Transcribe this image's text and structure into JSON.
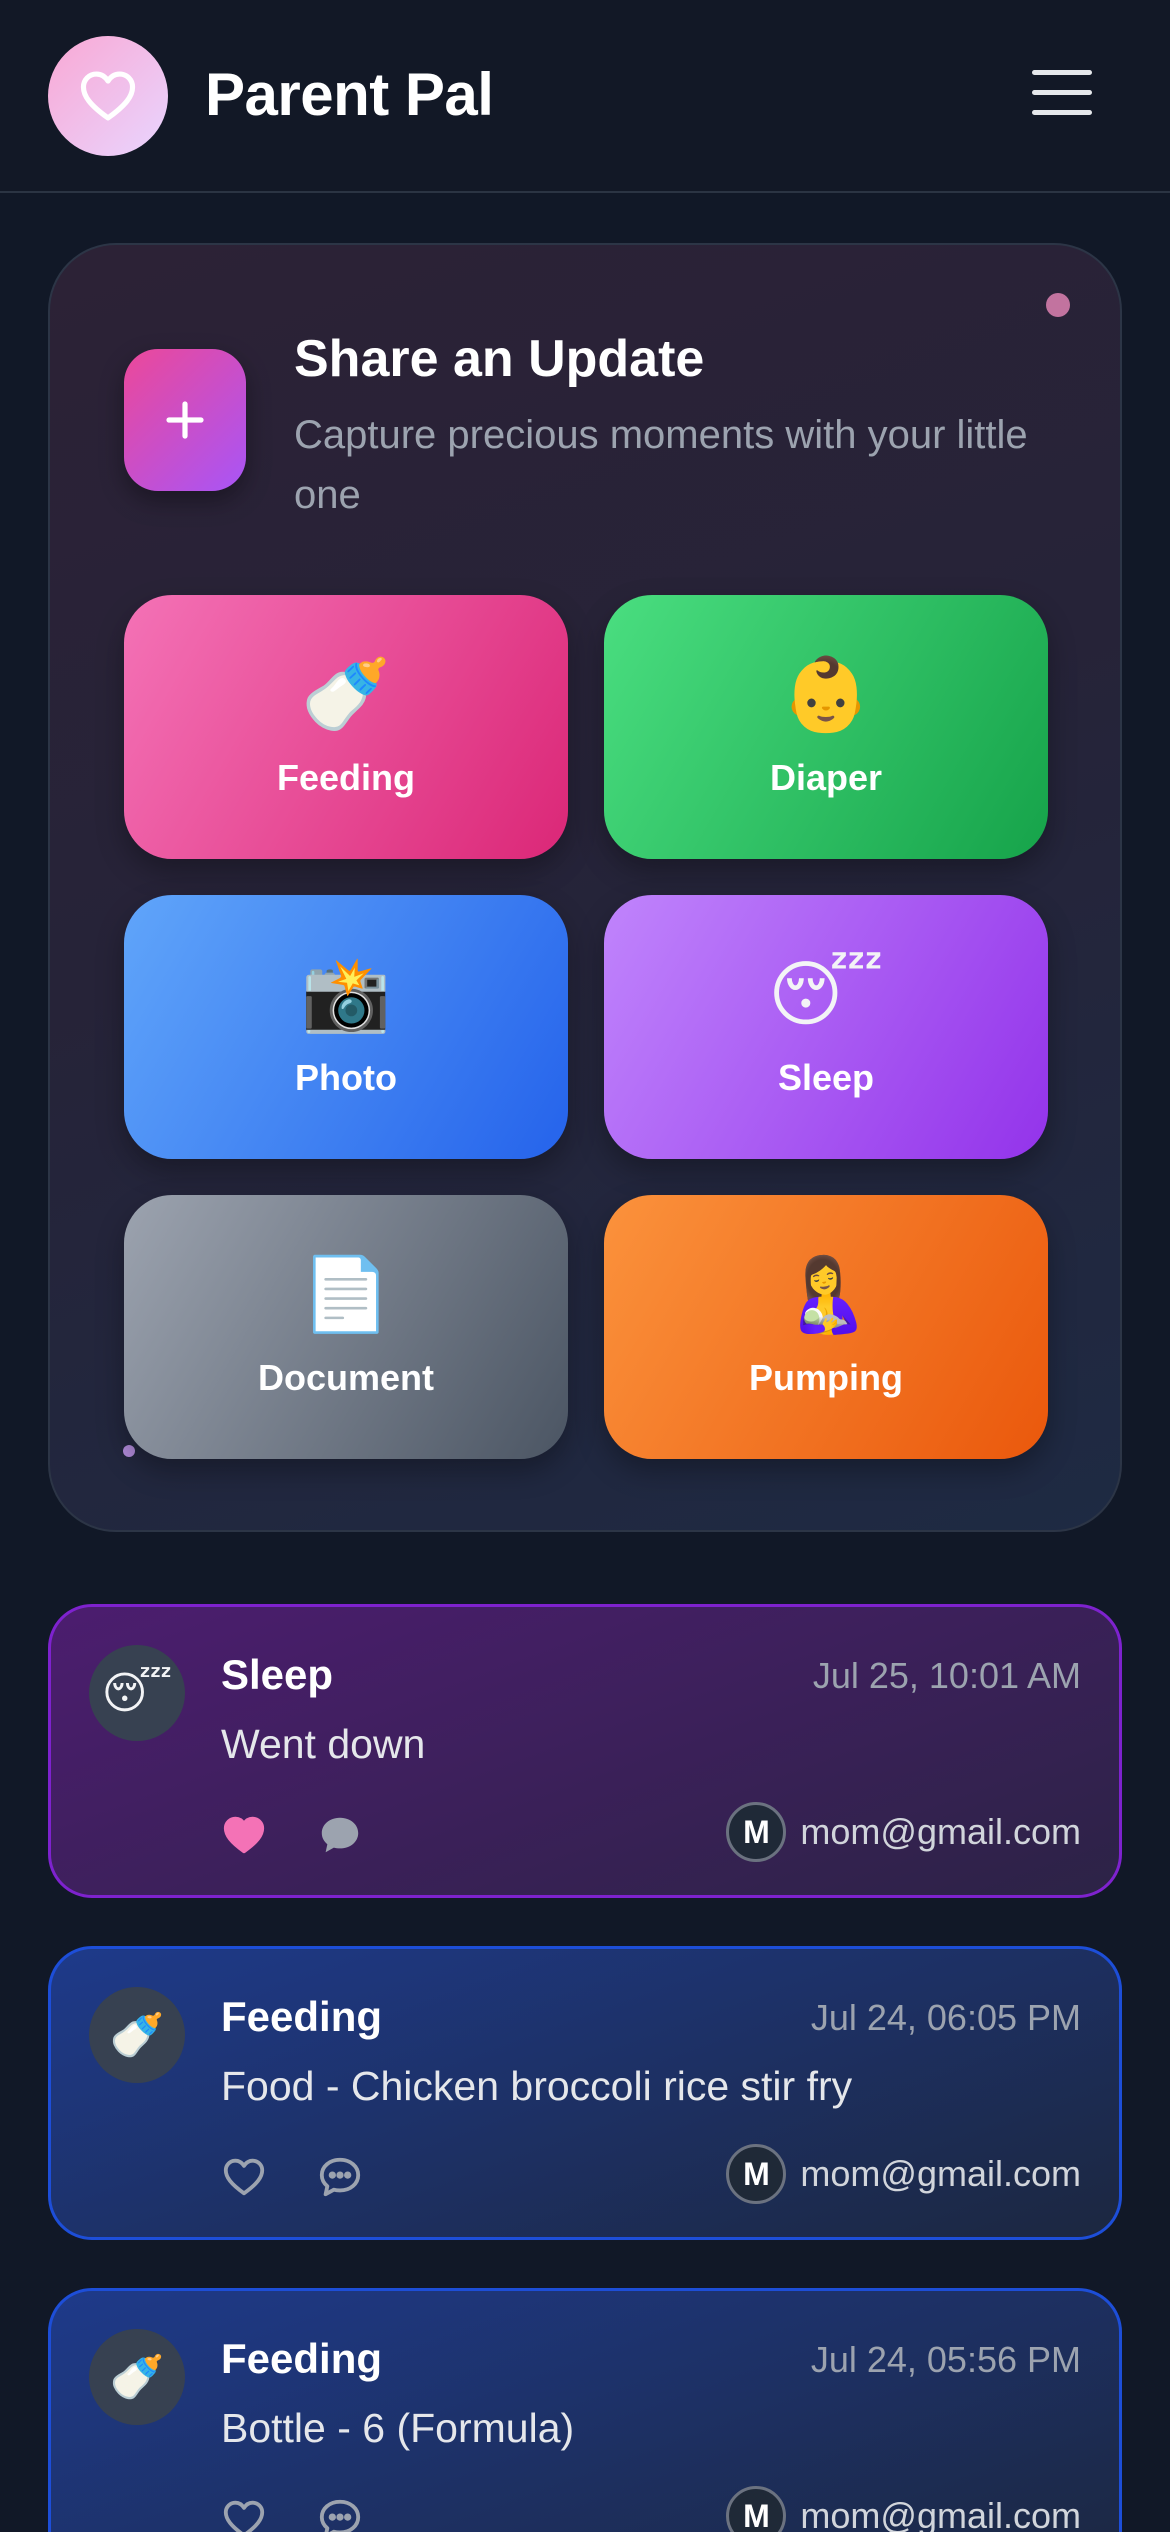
{
  "header": {
    "logo_icon": "heart-icon",
    "title": "Parent Pal",
    "menu_icon": "hamburger-menu-icon"
  },
  "share": {
    "plus_icon": "plus-icon",
    "title": "Share an Update",
    "subtitle": "Capture precious moments with your little one",
    "tiles": [
      {
        "emoji": "🍼",
        "label": "Feeding",
        "color": "#ec4899"
      },
      {
        "emoji": "👶",
        "label": "Diaper",
        "color": "#22c55e"
      },
      {
        "emoji": "📸",
        "label": "Photo",
        "color": "#3b82f6"
      },
      {
        "emoji": "😴",
        "label": "Sleep",
        "color": "#a855f7"
      },
      {
        "emoji": "📄",
        "label": "Document",
        "color": "#6b7280"
      },
      {
        "emoji": "🤱",
        "label": "Pumping",
        "color": "#f97316"
      }
    ]
  },
  "feed": [
    {
      "emoji": "😴",
      "type": "Sleep",
      "time": "Jul 25, 10:01 AM",
      "description": "Went down",
      "liked": true,
      "user_initial": "M",
      "user_email": "mom@gmail.com",
      "accent": "#7e22ce"
    },
    {
      "emoji": "🍼",
      "type": "Feeding",
      "time": "Jul 24, 06:05 PM",
      "description": "Food - Chicken broccoli rice stir fry",
      "liked": false,
      "user_initial": "M",
      "user_email": "mom@gmail.com",
      "accent": "#1d4ed8"
    },
    {
      "emoji": "🍼",
      "type": "Feeding",
      "time": "Jul 24, 05:56 PM",
      "description": "Bottle - 6 (Formula)",
      "liked": false,
      "user_initial": "M",
      "user_email": "mom@gmail.com",
      "accent": "#1d4ed8"
    }
  ],
  "colors": {
    "background": "#111827",
    "like_active": "#f472b6"
  }
}
